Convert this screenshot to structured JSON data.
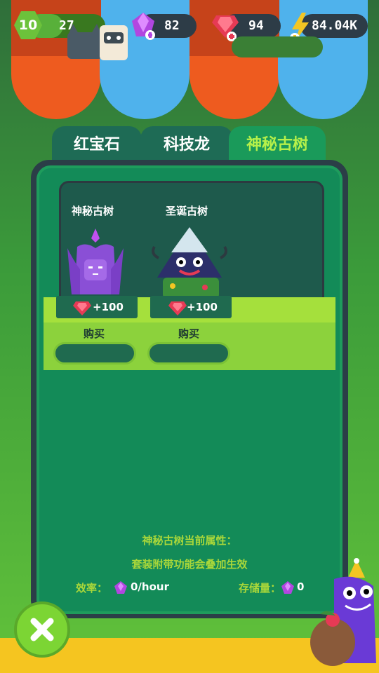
{
  "hud": {
    "level": "10",
    "xp": "27",
    "xp_fraction": 0.45,
    "purple_gems": "82",
    "red_gems": "94",
    "energy": "84.04K"
  },
  "tabs": [
    {
      "label": "红宝石"
    },
    {
      "label": "科技龙"
    },
    {
      "label": "神秘古树",
      "active": true
    }
  ],
  "items": [
    {
      "name": "神秘古树",
      "price": "+100",
      "buy_label": "购买"
    },
    {
      "name": "圣诞古树",
      "price": "+100",
      "buy_label": "购买"
    }
  ],
  "info": {
    "line1": "神秘古树当前属性：",
    "line2": "套装附带功能会叠加生效"
  },
  "stats": {
    "efficiency_label": "效率：",
    "efficiency_value": "0/hour",
    "storage_label": "存储量：",
    "storage_value": "0"
  },
  "colors": {
    "accent_green": "#a9d73a",
    "panel_green": "#138b58",
    "red_gem": "#e63a55",
    "purple_gem": "#b146e0",
    "energy_yellow": "#f3c623"
  },
  "icons": {
    "close": "close-icon",
    "purple_gem": "purple-gem-icon",
    "red_gem": "red-gem-icon",
    "energy": "lightning-icon"
  }
}
